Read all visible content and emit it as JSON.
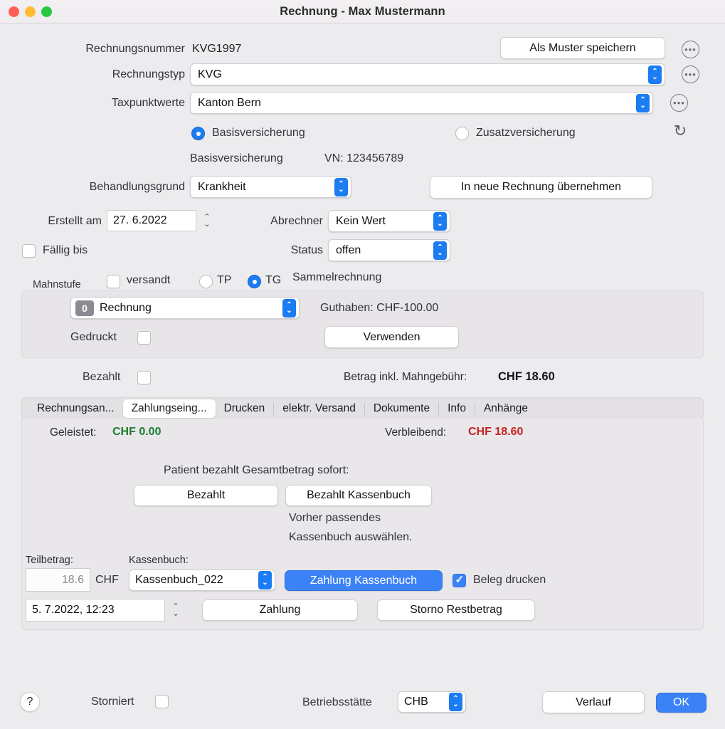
{
  "window": {
    "title": "Rechnung - Max Mustermann",
    "traffic_lights": [
      "close",
      "minimize",
      "zoom"
    ]
  },
  "form": {
    "invoice_number_label": "Rechnungsnummer",
    "invoice_number_value": "KVG1997",
    "save_template_button": "Als Muster speichern",
    "invoice_type_label": "Rechnungstyp",
    "invoice_type_value": "KVG",
    "tariff_label": "Taxpunktwerte",
    "tariff_value": "Kanton Bern",
    "insurance_basic_radio": "Basisversicherung",
    "insurance_extra_radio": "Zusatzversicherung",
    "insurance_info_name": "Basisversicherung",
    "insurance_info_vn": "VN: 123456789",
    "treatment_reason_label": "Behandlungsgrund",
    "treatment_reason_value": "Krankheit",
    "copy_to_new_invoice_button": "In neue Rechnung übernehmen",
    "created_label": "Erstellt am",
    "created_value": "27.  6.2022",
    "biller_label": "Abrechner",
    "biller_value": "Kein Wert",
    "due_label": "Fällig bis",
    "status_label": "Status",
    "status_value": "offen",
    "reminder_level_label": "Mahnstufe",
    "sent_checkbox_label": "versandt",
    "tp_radio_label": "TP",
    "tg_radio_label": "TG",
    "collective_invoice_label": "Sammelrechnung"
  },
  "reminder_panel": {
    "level_badge": "0",
    "level_value": "Rechnung",
    "credit_text": "Guthaben: CHF-100.00",
    "printed_label": "Gedruckt",
    "use_button": "Verwenden"
  },
  "paid_row": {
    "paid_label": "Bezahlt",
    "amount_label": "Betrag inkl. Mahngebühr:",
    "amount_value": "CHF 18.60"
  },
  "tabs": [
    {
      "label": "Rechnungsan...",
      "active": false
    },
    {
      "label": "Zahlungseing...",
      "active": true
    },
    {
      "label": "Drucken",
      "active": false
    },
    {
      "label": "elektr. Versand",
      "active": false
    },
    {
      "label": "Dokumente",
      "active": false
    },
    {
      "label": "Info",
      "active": false
    },
    {
      "label": "Anhänge",
      "active": false
    }
  ],
  "payment_tab": {
    "paid_so_far_label": "Geleistet:",
    "paid_so_far_value": "CHF 0.00",
    "remaining_label": "Verbleibend:",
    "remaining_value": "CHF 18.60",
    "instant_payment_title": "Patient bezahlt Gesamtbetrag sofort:",
    "paid_button": "Bezahlt",
    "paid_cashbook_button": "Bezahlt Kassenbuch",
    "hint_line1": "Vorher passendes",
    "hint_line2": "Kassenbuch auswählen.",
    "partial_amount_label": "Teilbetrag:",
    "partial_amount_value": "18.6",
    "currency_label": "CHF",
    "cashbook_label": "Kassenbuch:",
    "cashbook_value": "Kassenbuch_022",
    "payment_cashbook_button": "Zahlung Kassenbuch",
    "print_receipt_label": "Beleg drucken",
    "payment_date_value": "5.  7.2022, 12:23",
    "payment_button": "Zahlung",
    "cancel_remaining_button": "Storno Restbetrag"
  },
  "footer": {
    "help_button": "?",
    "cancelled_label": "Storniert",
    "site_label": "Betriebsstätte",
    "site_value": "CHB",
    "history_button": "Verlauf",
    "ok_button": "OK"
  },
  "icons": {
    "ellipsis": "•••",
    "refresh": "↻",
    "chevron_up": "⌃",
    "chevron_down": "⌄"
  },
  "colors": {
    "accent": "#3b82f6",
    "popup_arrow": "#1c7cf2",
    "green": "#1a7f2e",
    "red": "#c62222",
    "window_bg": "#ecebed",
    "panel_bg": "#e7e5e8"
  }
}
